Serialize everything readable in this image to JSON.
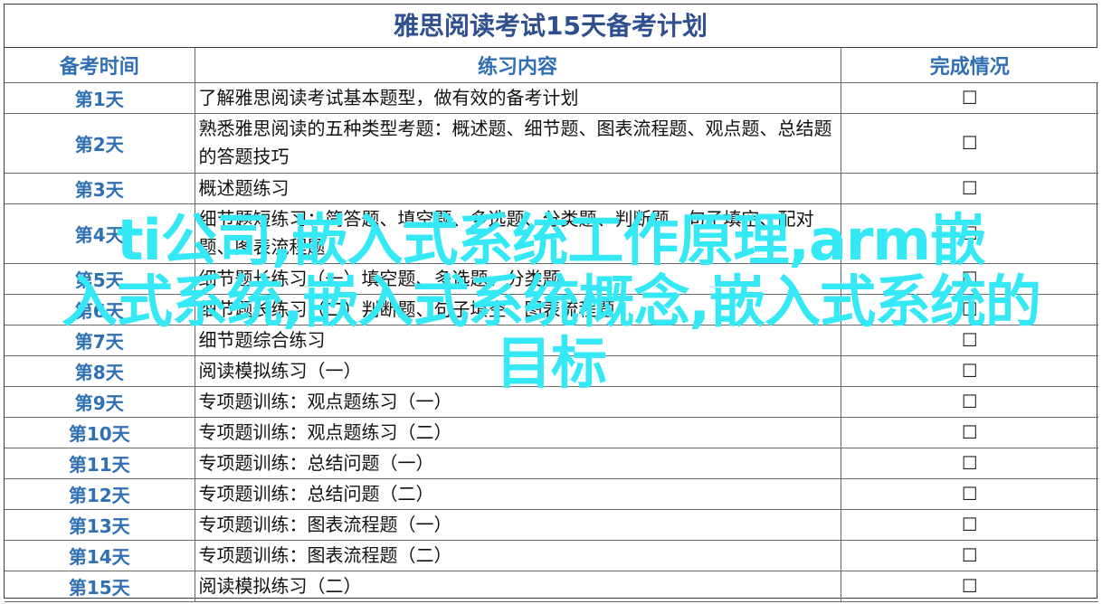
{
  "title": "雅思阅读考试15天备考计划",
  "headers": {
    "day": "备考时间",
    "content": "练习内容",
    "status": "完成情况"
  },
  "checkbox_symbol": "☐",
  "rows": [
    {
      "day": "第1天",
      "content": "了解雅思阅读考试基本题型，做有效的备考计划",
      "lines": 1
    },
    {
      "day": "第2天",
      "content": "熟悉雅思阅读的五种类型考题：概述题、细节题、图表流程题、观点题、总结题的答题技巧",
      "lines": 2
    },
    {
      "day": "第3天",
      "content": "概述题练习",
      "lines": 1
    },
    {
      "day": "第4天",
      "content": "细节题短练习：简答题、填空题、多选题、分类题、判断题、句子填空、配对题、图表流程题",
      "lines": 2
    },
    {
      "day": "第5天",
      "content": "细节题长练习（一）填空题、多选题、分类题",
      "lines": 1
    },
    {
      "day": "第6天",
      "content": "细节题长练习（二）判断题、句子填空、图表流程题",
      "lines": 1
    },
    {
      "day": "第7天",
      "content": "细节题综合练习",
      "lines": 1
    },
    {
      "day": "第8天",
      "content": "阅读模拟练习（一）",
      "lines": 1
    },
    {
      "day": "第9天",
      "content": "专项题训练：观点题练习（一）",
      "lines": 1
    },
    {
      "day": "第10天",
      "content": "专项题训练：观点题练习（二）",
      "lines": 1
    },
    {
      "day": "第11天",
      "content": "专项题训练：总结问题（一）",
      "lines": 1
    },
    {
      "day": "第12天",
      "content": "专项题训练：总结问题（二）",
      "lines": 1
    },
    {
      "day": "第13天",
      "content": "专项题训练：图表流程题（一）",
      "lines": 1
    },
    {
      "day": "第14天",
      "content": "专项题训练：图表流程题（二）",
      "lines": 1
    },
    {
      "day": "第15天",
      "content": "阅读模拟练习（二）",
      "lines": 1
    }
  ],
  "watermark": {
    "line1": "ti公司,嵌入式系统工作原理,arm嵌",
    "line2": "入式系统,嵌入式系统概念,嵌入式系统的",
    "line3": "目标",
    "color": "#35e8f5"
  }
}
